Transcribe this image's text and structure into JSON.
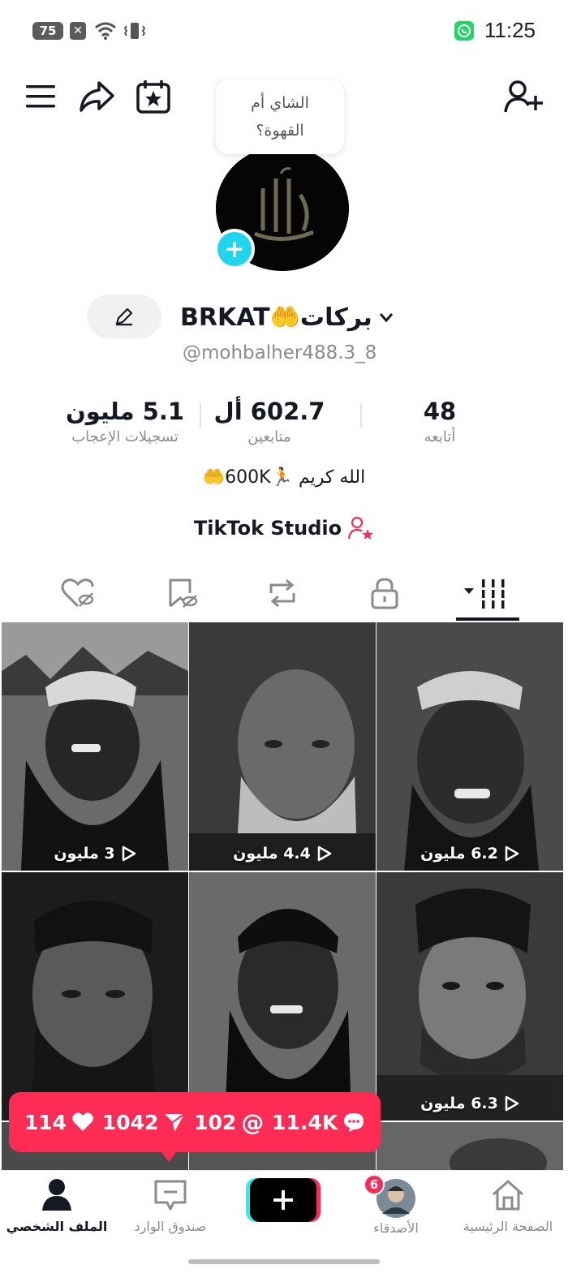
{
  "status_bar": {
    "battery": "75",
    "time": "11:25",
    "x_badge": "✕"
  },
  "bubble_text": "الشاي أم\nالقهوة؟",
  "profile": {
    "display_name": "BRKAT🤲بركات",
    "handle": "@mohbalher488.3_8",
    "bio": "الله كريم 🏃600K🤲",
    "studio_label": "TikTok Studio"
  },
  "stats": [
    {
      "value": "48",
      "label": "أتابعه"
    },
    {
      "value": "602.7 أل",
      "label": "متابعين"
    },
    {
      "value": "5.1 مليون",
      "label": "تسجيلات الإعجاب"
    }
  ],
  "videos": [
    {
      "views": "6.2 مليون"
    },
    {
      "views": "4.4 مليون"
    },
    {
      "views": "3 مليون"
    },
    {
      "views": "6.3 مليون"
    },
    {
      "views": ""
    },
    {
      "views": ""
    }
  ],
  "engagement": {
    "comments": "11.4K",
    "mentions": "102",
    "shares": "1042",
    "likes": "114"
  },
  "nav": {
    "home": "الصفحة الرئيسية",
    "friends": "الأصدقاء",
    "friends_badge": "6",
    "inbox": "صندوق الوارد",
    "profile": "الملف الشخصي"
  },
  "colors": {
    "accent": "#fe2c55",
    "cyan": "#25f4ee",
    "add_badge": "#20d5ec"
  }
}
